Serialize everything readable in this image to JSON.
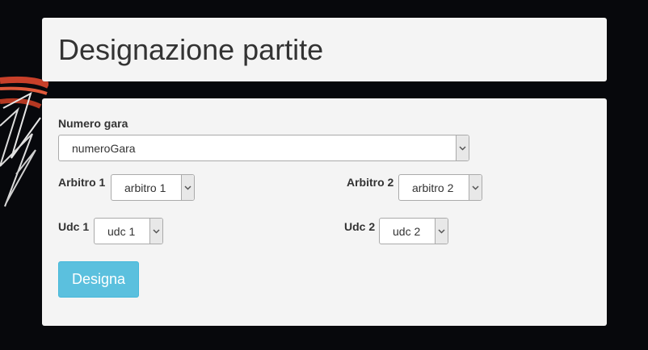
{
  "page": {
    "title": "Designazione partite"
  },
  "form": {
    "numero_gara": {
      "label": "Numero gara",
      "value": "numeroGara"
    },
    "arbitro1": {
      "label": "Arbitro 1",
      "value": "arbitro 1"
    },
    "arbitro2": {
      "label": "Arbitro 2",
      "value": "arbitro 2"
    },
    "udc1": {
      "label": "Udc 1",
      "value": "udc 1"
    },
    "udc2": {
      "label": "Udc 2",
      "value": "udc 2"
    },
    "submit_label": "Designa"
  },
  "icons": {
    "select_arrow": "chevron-down-icon",
    "background": "basketball-hoop-image"
  },
  "colors": {
    "background": "#07080c",
    "panel": "#f4f4f4",
    "button": "#5bc0de",
    "button_text": "#ffffff"
  }
}
